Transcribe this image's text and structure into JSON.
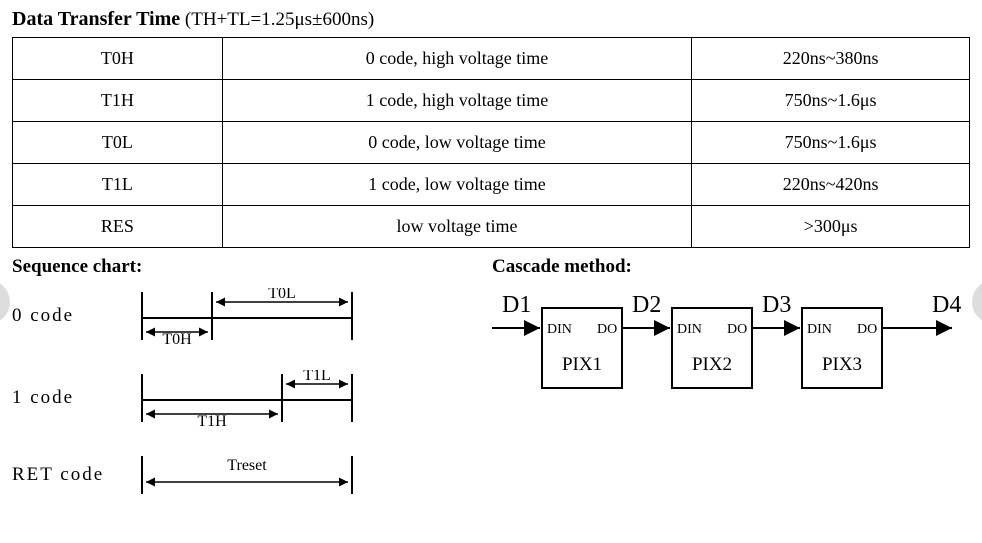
{
  "title_bold": "Data Transfer Time",
  "title_rest": " (TH+TL=1.25μs±600ns)",
  "table": {
    "rows": [
      {
        "sym": "T0H",
        "desc": "0 code, high voltage time",
        "val": "220ns~380ns"
      },
      {
        "sym": "T1H",
        "desc": "1 code, high voltage time",
        "val": "750ns~1.6μs"
      },
      {
        "sym": "T0L",
        "desc": "0 code, low voltage time",
        "val": "750ns~1.6μs"
      },
      {
        "sym": "T1L",
        "desc": "1 code, low voltage time",
        "val": "220ns~420ns"
      },
      {
        "sym": "RES",
        "desc": "low voltage time",
        "val": ">300μs"
      }
    ]
  },
  "seq_header": "Sequence chart:",
  "cascade_header": "Cascade method:",
  "seq": {
    "code0_label": "0 code",
    "code1_label": "1 code",
    "ret_label": "RET code",
    "t0h": "T0H",
    "t0l": "T0L",
    "t1h": "T1H",
    "t1l": "T1L",
    "treset": "Treset"
  },
  "cascade": {
    "d1": "D1",
    "d2": "D2",
    "d3": "D3",
    "d4": "D4",
    "din": "DIN",
    "do": "DO",
    "pix1": "PIX1",
    "pix2": "PIX2",
    "pix3": "PIX3"
  }
}
